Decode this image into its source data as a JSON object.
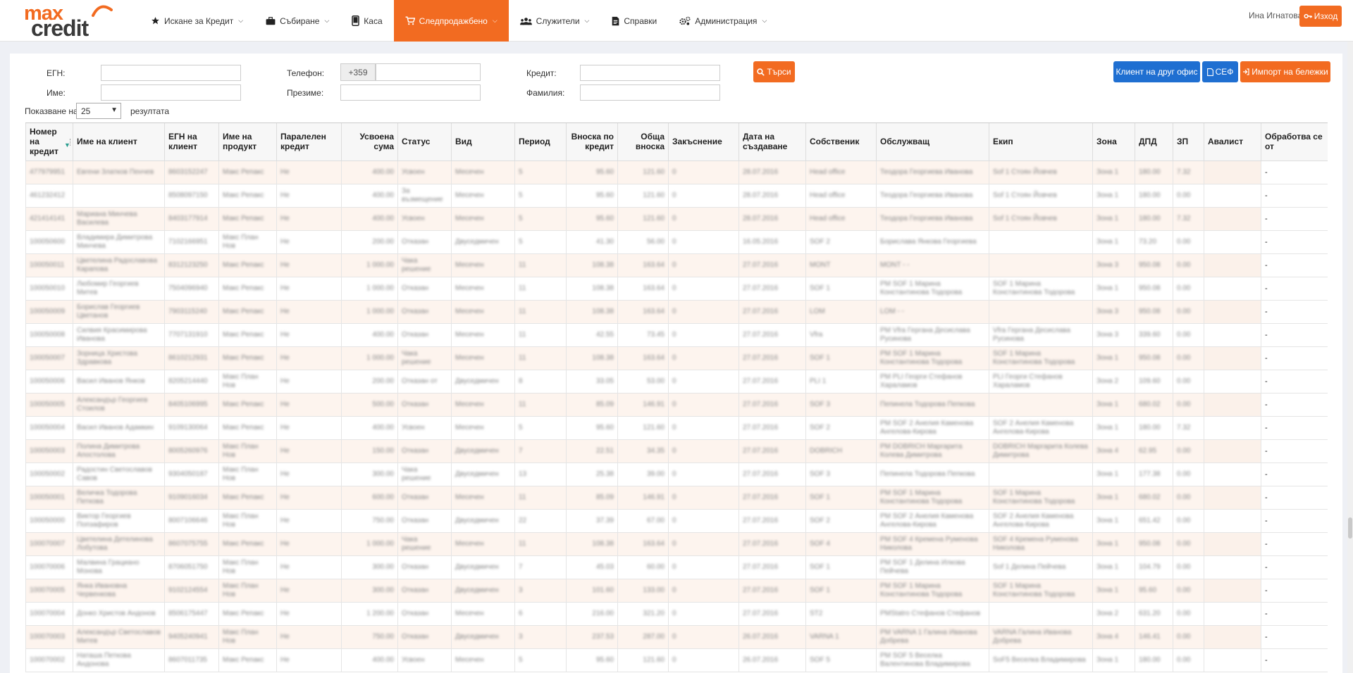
{
  "logo": {
    "line1": "max",
    "line2": "credit"
  },
  "colors": {
    "accent": "#f26b21",
    "blue": "#1f6fd1",
    "row_alt": "#fdf4ee"
  },
  "nav": [
    {
      "label": "Искане за Кредит",
      "icon": "star-icon",
      "dropdown": true
    },
    {
      "label": "Събиране",
      "icon": "briefcase-icon",
      "dropdown": true
    },
    {
      "label": "Каса",
      "icon": "phone-icon",
      "dropdown": false
    },
    {
      "label": "Следпродажбено",
      "icon": "cart-icon",
      "dropdown": true,
      "active": true
    },
    {
      "label": "Служители",
      "icon": "users-icon",
      "dropdown": true
    },
    {
      "label": "Справки",
      "icon": "document-icon",
      "dropdown": false
    },
    {
      "label": "Администрация",
      "icon": "gears-icon",
      "dropdown": true
    }
  ],
  "user": {
    "name": "Ина Игнатова",
    "logout": "Изход"
  },
  "filters": {
    "egn": "ЕГН:",
    "phone": "Телефон:",
    "phone_prefix": "+359",
    "credit": "Кредит:",
    "name": "Име:",
    "surname": "Презиме:",
    "family": "Фамилия:",
    "search": "Търси"
  },
  "actions": {
    "other_office": "Клиент на друг офис",
    "sef": "СЕФ",
    "import": "Импорт на бележки"
  },
  "page_size": {
    "prefix": "Показване на",
    "value": "25",
    "suffix": "резултата"
  },
  "columns": [
    "Номер на кредит",
    "Име на клиент",
    "ЕГН на клиент",
    "Име на продукт",
    "Паралелен кредит",
    "Усвоена сума",
    "Статус",
    "Вид",
    "Период",
    "Вноска по кредит",
    "Обща вноска",
    "Закъснение",
    "Дата на създаване",
    "Собственик",
    "Обслужващ",
    "Екип",
    "Зона",
    "ДПД",
    "ЗП",
    "Авалист",
    "Обработва се от"
  ],
  "rows": [
    [
      "477979951",
      "Евгени Златков Пенчев",
      "8603152247",
      "Макс Репакс",
      "Не",
      "400.00",
      "Усвоен",
      "Месечен",
      "5",
      "95.60",
      "121.60",
      "0",
      "28.07.2016",
      "Head office",
      "Теодора Георгиева Иванова",
      "Sof 1 Стоян Йовчев",
      "Зона 1",
      "180.00",
      "7.32",
      "",
      "-"
    ],
    [
      "461232412",
      "",
      "8508097150",
      "Макс Репакс",
      "Не",
      "400.00",
      "За възмещение",
      "Месечен",
      "5",
      "95.60",
      "121.60",
      "0",
      "28.07.2016",
      "Head office",
      "Теодора Георгиева Иванова",
      "Sof 1 Стоян Йовчев",
      "Зона 1",
      "180.00",
      "0.00",
      "",
      "-"
    ],
    [
      "421414141",
      "Мариана Минчева Василева",
      "8403177914",
      "Макс Репакс",
      "Не",
      "400.00",
      "Усвоен",
      "Месечен",
      "5",
      "95.60",
      "121.60",
      "0",
      "28.07.2016",
      "Head office",
      "Теодора Георгиева Иванова",
      "Sof 1 Стоян Йовчев",
      "Зона 1",
      "180.00",
      "7.32",
      "",
      "-"
    ],
    [
      "100050600",
      "Владимира Димитрова Минчева",
      "7102166951",
      "Макс План Нов",
      "Не",
      "200.00",
      "Отказан",
      "Двуседмичен",
      "5",
      "41.30",
      "56.00",
      "0",
      "16.05.2016",
      "SOF 2",
      "Борислава Янкова Георгиева",
      "",
      "Зона 1",
      "73.20",
      "0.00",
      "",
      "-"
    ],
    [
      "100050011",
      "Цветелина Радославова Карапова",
      "8312123250",
      "Макс Репакс",
      "Не",
      "1 000.00",
      "Чака решение",
      "Месечен",
      "11",
      "108.38",
      "163.64",
      "0",
      "27.07.2016",
      "MONT",
      "MONT - -",
      "",
      "Зона 3",
      "950.08",
      "0.00",
      "",
      "-"
    ],
    [
      "100050010",
      "Любомир Георгиев Митев",
      "7504096940",
      "Макс Репакс",
      "Не",
      "1 000.00",
      "Отказан",
      "Месечен",
      "11",
      "108.38",
      "163.64",
      "0",
      "27.07.2016",
      "SOF 1",
      "PM SOF 1 Марина Константинова Тодорова",
      "SOF 1 Марина Константинова Тодорова",
      "Зона 1",
      "950.08",
      "0.00",
      "",
      "-"
    ],
    [
      "100050009",
      "Борислав Георгиев Цветанов",
      "7903115240",
      "Макс Репакс",
      "Не",
      "1 000.00",
      "Отказан",
      "Месечен",
      "11",
      "108.38",
      "163.64",
      "0",
      "27.07.2016",
      "LOM",
      "LOM - -",
      "",
      "Зона 3",
      "950.08",
      "0.00",
      "",
      "-"
    ],
    [
      "100050008",
      "Силвия Красимирова Иванова",
      "7707131910",
      "Макс Репакс",
      "Не",
      "400.00",
      "Отказан",
      "Месечен",
      "11",
      "42.55",
      "73.45",
      "0",
      "27.07.2016",
      "Vfra",
      "PM Vfra Гергана Десислава Русинова",
      "Vfra Гергана Десислава Русинова",
      "Зона 3",
      "339.60",
      "0.00",
      "",
      "-"
    ],
    [
      "100050007",
      "Зорница Христова Здравкова",
      "8610212931",
      "Макс Репакс",
      "Не",
      "1 000.00",
      "Чака решение",
      "Месечен",
      "11",
      "108.38",
      "163.64",
      "0",
      "27.07.2016",
      "SOF 1",
      "PM SOF 1 Марина Константинова Тодорова",
      "SOF 1 Марина Константинова Тодорова",
      "Зона 1",
      "950.08",
      "0.00",
      "",
      "-"
    ],
    [
      "100050006",
      "Васил Иванов Янков",
      "8205214440",
      "Макс План Нов",
      "Не",
      "200.00",
      "Отказан от",
      "Двуседмичен",
      "8",
      "33.05",
      "53.00",
      "0",
      "27.07.2016",
      "PLI 1",
      "PM PLI Георги Стефанов Хараламов",
      "PLI Георги Стефанов Хараламов",
      "Зона 2",
      "109.60",
      "0.00",
      "",
      "-"
    ],
    [
      "100050005",
      "Александър Георгиев Стоилов",
      "8405106995",
      "Макс Репакс",
      "Не",
      "500.00",
      "Отказан",
      "Месечен",
      "11",
      "85.09",
      "146.91",
      "0",
      "27.07.2016",
      "SOF 3",
      "Пепинела Тодорова Пепкова",
      "",
      "Зона 1",
      "680.02",
      "0.00",
      "",
      "-"
    ],
    [
      "100050004",
      "Васил Иванов Адамкин",
      "9109130064",
      "Макс Репакс",
      "Не",
      "400.00",
      "Усвоен",
      "Месечен",
      "5",
      "95.60",
      "121.60",
      "0",
      "27.07.2016",
      "SOF 2",
      "PM SOF 2 Анелия Каменова Ангелова-Кирова",
      "SOF 2 Анелия Каменова Ангелова-Кирова",
      "Зона 1",
      "180.00",
      "7.32",
      "",
      "-"
    ],
    [
      "100050003",
      "Полина Димитрова Апостолова",
      "8005260976",
      "Макс План Нов",
      "Не",
      "150.00",
      "Отказан",
      "Двуседмичен",
      "7",
      "22.51",
      "34.35",
      "0",
      "27.07.2016",
      "DOBRICH",
      "PM DOBRICH Маргарита Колева Димитрова",
      "DOBRICH Маргарита Колева Димитрова",
      "Зона 4",
      "62.95",
      "0.00",
      "",
      "-"
    ],
    [
      "100050002",
      "Радостин Светославов Савов",
      "9304050187",
      "Макс План Нов",
      "Не",
      "300.00",
      "Чака решение",
      "Двуседмичен",
      "13",
      "25.38",
      "39.00",
      "0",
      "27.07.2016",
      "SOF 3",
      "Пепинела Тодорова Пепкова",
      "",
      "Зона 1",
      "177.38",
      "0.00",
      "",
      "-"
    ],
    [
      "100050001",
      "Величка Тодорова Петкова",
      "9109016034",
      "Макс Репакс",
      "Не",
      "600.00",
      "Отказан",
      "Месечен",
      "11",
      "85.09",
      "146.91",
      "0",
      "27.07.2016",
      "SOF 1",
      "PM SOF 1 Марина Константинова Тодорова",
      "SOF 1 Марина Константинова Тодорова",
      "Зона 1",
      "680.02",
      "0.00",
      "",
      "-"
    ],
    [
      "100050000",
      "Виктор Георгиев Попзафиров",
      "8007106646",
      "Макс План Нов",
      "Не",
      "750.00",
      "Отказан",
      "Двуседмичен",
      "22",
      "37.39",
      "67.00",
      "0",
      "27.07.2016",
      "SOF 2",
      "PM SOF 2 Анелия Каменова Ангелова-Кирова",
      "SOF 2 Анелия Каменова Ангелова-Кирова",
      "Зона 1",
      "651.42",
      "0.00",
      "",
      "-"
    ],
    [
      "100070007",
      "Цветелина Детелинова Лобутова",
      "8607075755",
      "Макс Репакс",
      "Не",
      "1 000.00",
      "Чака решение",
      "Месечен",
      "11",
      "108.38",
      "163.64",
      "0",
      "27.07.2016",
      "SOF 4",
      "PM SOF 4 Кремена Руменова Николова",
      "SOF 4 Кремена Руменова Николова",
      "Зона 1",
      "950.08",
      "0.00",
      "",
      "-"
    ],
    [
      "100070006",
      "Малвина Грациано Монова",
      "8706051750",
      "Макс План Нов",
      "Не",
      "300.00",
      "Отказан",
      "Двуседмичен",
      "7",
      "45.03",
      "60.00",
      "0",
      "27.07.2016",
      "SOF 1",
      "PM SOF 1 Делина Илкова Пейчева",
      "Sof 1 Делина Пейчева",
      "Зона 1",
      "104.79",
      "0.00",
      "",
      "-"
    ],
    [
      "100070005",
      "Янка Ивановна Червенкова",
      "9102124554",
      "Макс План Нов",
      "Не",
      "300.00",
      "Отказан",
      "Двуседмичен",
      "3",
      "101.60",
      "133.00",
      "0",
      "27.07.2016",
      "SOF 1",
      "PM SOF 1 Марина Константинова Тодорова",
      "SOF 1 Марина Константинова Тодорова",
      "Зона 1",
      "95.60",
      "0.00",
      "",
      "-"
    ],
    [
      "100070004",
      "Донко Христов Андонов",
      "8506175447",
      "Макс Репакс",
      "Не",
      "1 200.00",
      "Отказан",
      "Месечен",
      "6",
      "216.00",
      "321.20",
      "0",
      "27.07.2016",
      "ST2",
      "PMStatro Стефанов Стефанов",
      "",
      "Зона 2",
      "631.20",
      "0.00",
      "",
      "-"
    ],
    [
      "100070003",
      "Александър Светославов Митев",
      "9405240941",
      "Макс План Нов",
      "Не",
      "750.00",
      "Отказан",
      "Двуседмичен",
      "3",
      "237.53",
      "287.00",
      "0",
      "26.07.2016",
      "VARNA 1",
      "PM VARNA 1 Галина Иванова Добрева",
      "VARNA Галина Иванова Добрева",
      "Зона 4",
      "146.41",
      "0.00",
      "",
      "-"
    ],
    [
      "100070002",
      "Наташа Петкова Андонова",
      "8607011735",
      "Макс Репакс",
      "Не",
      "400.00",
      "Усвоен",
      "Месечен",
      "5",
      "95.60",
      "121.60",
      "0",
      "26.07.2016",
      "SOF 5",
      "PM SOF 5 Веселка Валентинова Владимирова",
      "SoF5 Веселка Владимирова",
      "Зона 1",
      "180.00",
      "0.00",
      "",
      "-"
    ]
  ]
}
